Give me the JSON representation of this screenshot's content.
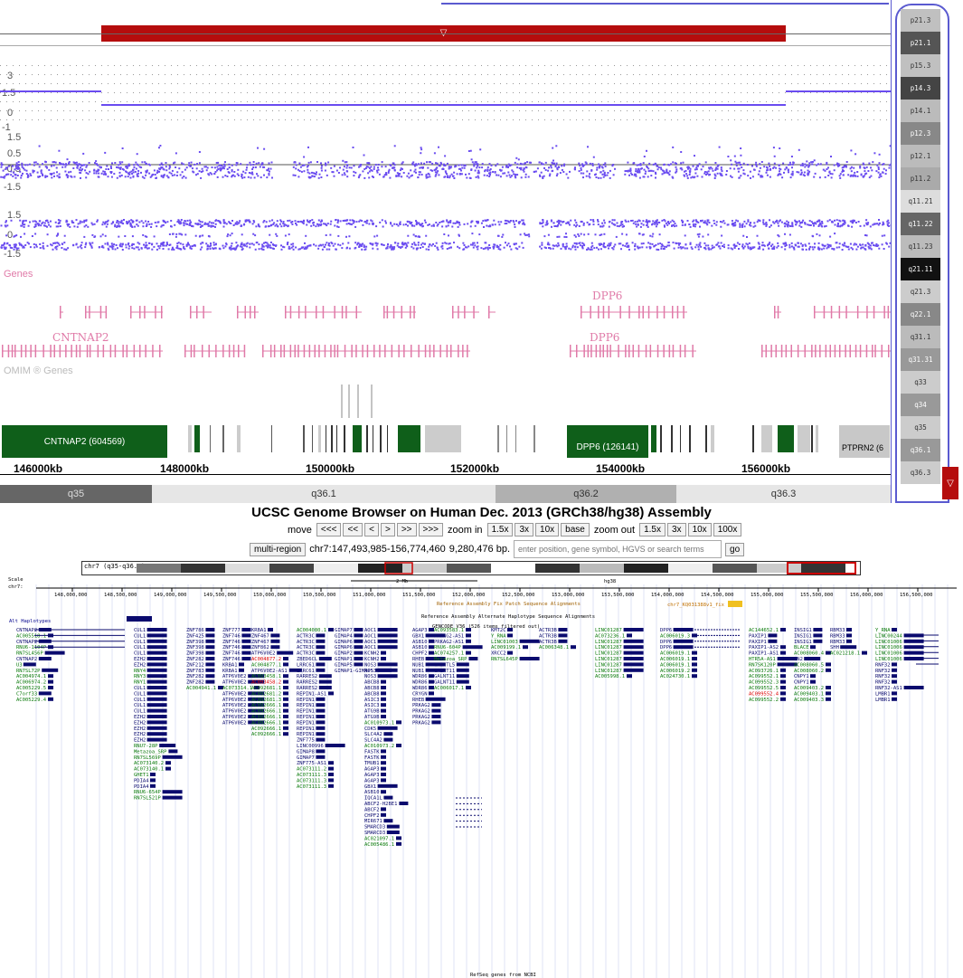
{
  "top_panel": {
    "copy_track_ticks": [
      "3",
      "1.5",
      "0",
      "-1"
    ],
    "logr_ticks": [
      "1.5",
      "0.5",
      "-0.5",
      "-1.5"
    ],
    "baf_ticks": [
      "1.5",
      "0",
      "-1.5"
    ],
    "genes_label": "Genes",
    "omim_label": "OMIM ® Genes",
    "gene_labels": [
      "DPP6",
      "CNTNAP2",
      "DPP6"
    ],
    "omim_blocks": [
      "CNTNAP2 (604569)",
      "DPP6 (126141)",
      "PTPRN2 (6"
    ],
    "axis_labels": [
      "146000kb",
      "148000kb",
      "150000kb",
      "152000kb",
      "154000kb",
      "156000kb"
    ],
    "bands": [
      "q35",
      "q36.1",
      "q36.2",
      "q36.3"
    ],
    "ideogram_bands": [
      "p21.3",
      "p21.1",
      "p15.3",
      "p14.3",
      "p14.1",
      "p12.3",
      "p12.1",
      "p11.2",
      "q11.21",
      "q11.22",
      "q11.23",
      "q21.11",
      "q21.3",
      "q22.1",
      "q31.1",
      "q31.31",
      "q33",
      "q34",
      "q35",
      "q36.1",
      "q36.3"
    ],
    "region_marker": "▽"
  },
  "browser": {
    "title": "UCSC Genome Browser on Human Dec. 2013 (GRCh38/hg38) Assembly",
    "move_label": "move",
    "move_buttons": [
      "<<<",
      "<<",
      "<",
      ">",
      ">>",
      ">>>"
    ],
    "zoom_in_label": "zoom in",
    "zoom_in_buttons": [
      "1.5x",
      "3x",
      "10x",
      "base"
    ],
    "zoom_out_label": "zoom out",
    "zoom_out_buttons": [
      "1.5x",
      "3x",
      "10x",
      "100x"
    ],
    "multiregion_label": "multi-region",
    "position": "chr7:147,493,985-156,774,460",
    "size": "9,280,476 bp.",
    "search_placeholder": "enter position, gene symbol, HGVS or search terms",
    "go_label": "go",
    "ideogram_chrom": "chr7 (q35-q36.3)",
    "scale_label": "Scale",
    "chrom_label": "chr7:",
    "scale_bar": "2 Mb",
    "assembly": "hg38",
    "coords": [
      "148,000,000",
      "148,500,000",
      "149,000,000",
      "149,500,000",
      "150,000,000",
      "150,500,000",
      "151,000,000",
      "151,500,000",
      "152,000,000",
      "152,500,000",
      "153,000,000",
      "153,500,000",
      "154,000,000",
      "154,500,000",
      "155,000,000",
      "155,500,000",
      "156,000,000",
      "156,500,000"
    ],
    "fix_patch_label": "Reference Assembly Fix Patch Sequence Alignments",
    "alt_label": "Reference Assembly Alternate Haplotype Sequence Alignments",
    "alt_haplotypes_label": "Alt Haplotypes",
    "fix_patch_item": "chr7_KQ031388v1_fix",
    "gencode_label": "GENCODE V36 (526 items filtered out)",
    "refseq_label": "RefSeq genes from NCBI",
    "genes_col1": [
      "CNTNAP2",
      "AC005518.1",
      "CNTNAP2",
      "RNU6-1104P",
      "RN7SL456P",
      "CNTNAP2",
      "U3",
      "RN7SL72P",
      "AC004974.1",
      "AC006974.2",
      "AC005229.5",
      "C7orf33",
      "AC005229.4"
    ],
    "genes_col2": [
      "CUL1",
      "CUL1",
      "CUL1",
      "CUL1",
      "CUL1",
      "EZH2",
      "EZH2",
      "RNY4",
      "RNY3",
      "RNY1",
      "CUL1",
      "CUL1",
      "CUL1",
      "CUL1",
      "CUL1",
      "EZH2",
      "EZH2",
      "EZH2",
      "EZH2",
      "EZH2",
      "RNU7-28P",
      "Metazoa_SRP",
      "RN7SL569P",
      "AC073140.2",
      "AC073140.1",
      "GHET1",
      "PDIA4",
      "PDIA4",
      "RNU6-654P",
      "RN7SL521P"
    ],
    "genes_col3": [
      "ZNF786",
      "ZNF425",
      "ZNF398",
      "ZNF398",
      "ZNF398",
      "ZNF282",
      "ZNF212",
      "ZNF783",
      "ZNF282",
      "ZNF282",
      "AC004941.1"
    ],
    "genes_col4": [
      "ZNF777",
      "ZNF746",
      "ZNF746",
      "ZNF746",
      "ZNF746",
      "ZNF746",
      "KRBA1",
      "KRBA1",
      "ATP6V0E2",
      "ATP6V0E2",
      "AC073314.1",
      "ATP6V0E2",
      "ATP6V0E2",
      "ATP6V0E2",
      "ATP6V0E2",
      "ATP6V0E2",
      "ATP6V0E2"
    ],
    "genes_col5": [
      "KRBA1",
      "ZNF467",
      "ZNF467",
      "ZNF862",
      "ATP6V0E2",
      "AC004877.2",
      "AC004877.1",
      "ATP6V0E2-AS1",
      "AC093458.1",
      "AC093458.2",
      "AC092681.1",
      "AC092681.2",
      "AC092681.3",
      "AC092666.1",
      "AC092666.1",
      "AC092666.1",
      "AC092666.1",
      "AC092666.1",
      "AC092666.1"
    ],
    "genes_col6": [
      "AC004080.1",
      "ACTR3C",
      "ACTR3C",
      "ACTR3C",
      "ACTR3C",
      "ZBED6CL",
      "LRRC61",
      "LRRC61",
      "RARRES2",
      "RARRES2",
      "RARRES2",
      "REPIN1-AS1",
      "REPIN1",
      "REPIN1",
      "REPIN1",
      "REPIN1",
      "REPIN1",
      "REPIN1",
      "REPIN1",
      "ZNF775",
      "LINC00996",
      "GIMAP8",
      "GIMAP7",
      "ZNF775-AS1",
      "AC073111.2",
      "AC073111.3",
      "AC073111.3",
      "AC073111.3"
    ],
    "genes_col7": [
      "GIMAP7",
      "GIMAP4",
      "GIMAP6",
      "GIMAP6",
      "GIMAP2",
      "GIMAP1",
      "GIMAP5",
      "GIMAP1-GIMAP5"
    ],
    "genes_col8": [
      "AOC1",
      "AOC1",
      "AOC1",
      "AOC1",
      "KCNH2",
      "KCNH2",
      "NOS3",
      "NOS3",
      "NOS3",
      "ABCB8",
      "ABCB8",
      "ABCB8",
      "ASIC3",
      "ASIC3",
      "ATG9B",
      "ATG9B",
      "AC010973.1",
      "CDK5",
      "SLC4A2",
      "SLC4A2",
      "AC010973.2",
      "FASTK",
      "FASTK",
      "TMUB1",
      "AGAP3",
      "AGAP3",
      "AGAP3",
      "GBX1",
      "ASB10",
      "IQCA1L",
      "ABCF2-H2BE1",
      "ABCF2",
      "CHPF2",
      "MIR671",
      "SMARCD3",
      "SMARCD3",
      "AC021097.1",
      "AC005486.1"
    ],
    "genes_col9": [
      "AGAP3",
      "GBX1",
      "ASB10",
      "ASB10",
      "CHPF2",
      "RHEB",
      "NUB1",
      "NUB1",
      "WDR86",
      "WDR86",
      "WDR86",
      "CRYGN",
      "RHEB",
      "PRKAG2",
      "PRKAG2",
      "PRKAG2",
      "PRKAG2"
    ],
    "genes_col10": [
      "AC093583.1",
      "PRKAG2-AS1",
      "PRKAG2-AS1",
      "RNU6-604P",
      "AC074257.1",
      "Metazoa_SRP",
      "GALNTL5",
      "GALNT11",
      "GALNT11",
      "GALNT11",
      "AC006017.1"
    ],
    "genes_col11": [
      "KMT2C",
      "Y_RNA",
      "LINC01003",
      "AC009199.1",
      "XRCC2",
      "RN7SL645P"
    ],
    "genes_col12": [
      "ACTR3B",
      "ACTR3B",
      "ACTR3B",
      "AC006348.1"
    ],
    "genes_col13": [
      "LINC01287",
      "AC073236.1",
      "LINC01287",
      "LINC01287",
      "LINC01287",
      "LINC01287",
      "LINC01287",
      "LINC01287",
      "AC005998.1"
    ],
    "genes_col14": [
      "DPP6",
      "AC006019.3",
      "DPP6",
      "DPP6",
      "AC006019.1",
      "AC006019.1",
      "AC006019.1",
      "AC006019.2",
      "AC024730.1"
    ],
    "genes_col15": [
      "AC144652.1",
      "PAXIP1",
      "PAXIP1",
      "PAXIP1-AS2",
      "PAXIP1-AS1",
      "HTR5A-AS1",
      "RN7SK120P",
      "AC093726.1",
      "AC099552.1",
      "AC099552.3",
      "AC099552.5",
      "AC099552.4",
      "AC099552.2"
    ],
    "genes_col16": [
      "INSIG1",
      "INSIG1",
      "INSIG1",
      "BLACE",
      "AC008060.4",
      "EN2",
      "AC008060.5",
      "AC008060.2",
      "CNPY1",
      "CNPY1",
      "AC009403.2",
      "AC009403.1",
      "AC009403.3"
    ],
    "genes_col17": [
      "RBM33",
      "RBM33",
      "RBM33",
      "SHH",
      "AC021218.1"
    ],
    "genes_col18": [
      "Y_RNA",
      "LINC00244",
      "LINC01006",
      "LINC01006",
      "LINC01006",
      "LINC01006",
      "RNF32",
      "RNF32",
      "RNF32",
      "RNF32",
      "RNF32-AS1",
      "LMBR1",
      "LMBR1"
    ]
  },
  "colors": {
    "accent": "#5a5ad0",
    "marker": "#b50d0d",
    "pink": "#e07aa8",
    "omim_green": "#0f5f1a",
    "navy": "#0a0a6e",
    "green_text": "#0a7a0a"
  }
}
